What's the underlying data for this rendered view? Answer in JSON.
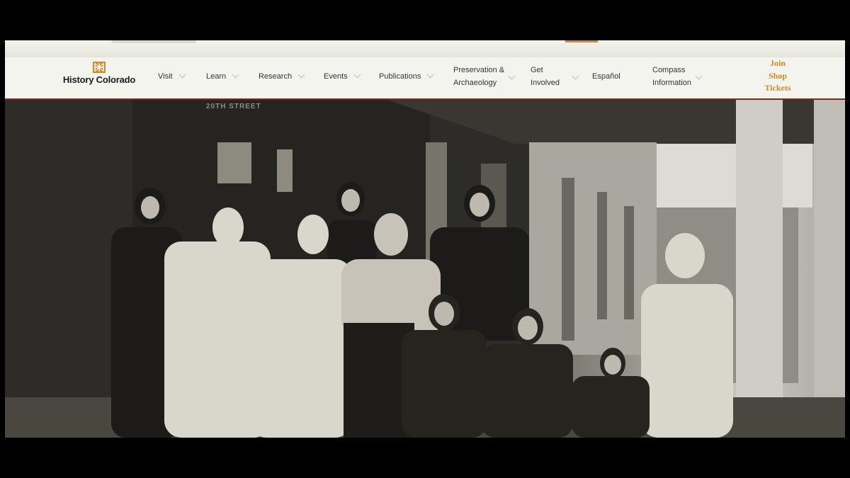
{
  "brand": {
    "name": "History Colorado",
    "logo_icon": "hc-star-icon",
    "accent": "#d4892c"
  },
  "nav": {
    "items": [
      {
        "label": "Visit"
      },
      {
        "label": "Learn"
      },
      {
        "label": "Research"
      },
      {
        "label": "Events"
      },
      {
        "label": "Publications"
      },
      {
        "line1": "Preservation &",
        "line2": "Archaeology"
      },
      {
        "line1": "Get",
        "line2": "Involved"
      },
      {
        "label": "Español"
      },
      {
        "line1": "Compass",
        "line2": "Information"
      }
    ],
    "cta": [
      "Join",
      "Shop",
      "Tickets"
    ]
  },
  "hero": {
    "sign_text": "20TH STREET",
    "image_icon": "historic-family-photo"
  }
}
